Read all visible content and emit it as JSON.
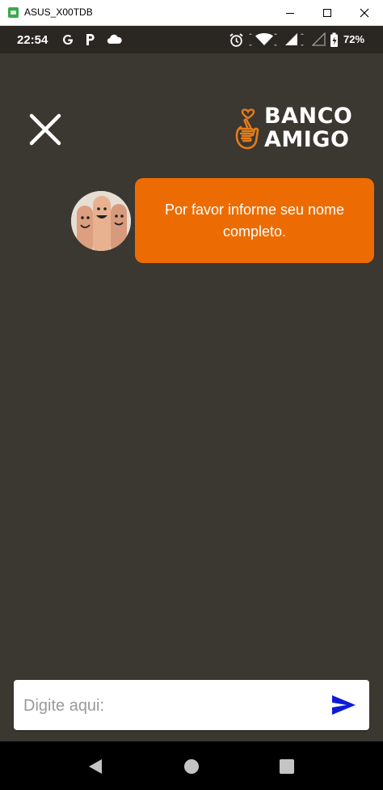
{
  "window": {
    "title": "ASUS_X00TDB"
  },
  "statusbar": {
    "time": "22:54",
    "icons": [
      "google-icon",
      "parking-icon",
      "cloud-icon",
      "alarm-icon",
      "wifi-icon",
      "signal-icon",
      "signal-icon",
      "battery-icon"
    ],
    "battery": "72%"
  },
  "header": {
    "logo_line1": "BANCO",
    "logo_line2": "AMIGO"
  },
  "chat": {
    "messages": [
      {
        "text": "Por favor informe seu nome completo."
      }
    ]
  },
  "composer": {
    "placeholder": "Digite aqui:",
    "value": ""
  },
  "colors": {
    "background": "#3b3731",
    "accent": "#ec6c03",
    "send": "#0d1bd8"
  }
}
